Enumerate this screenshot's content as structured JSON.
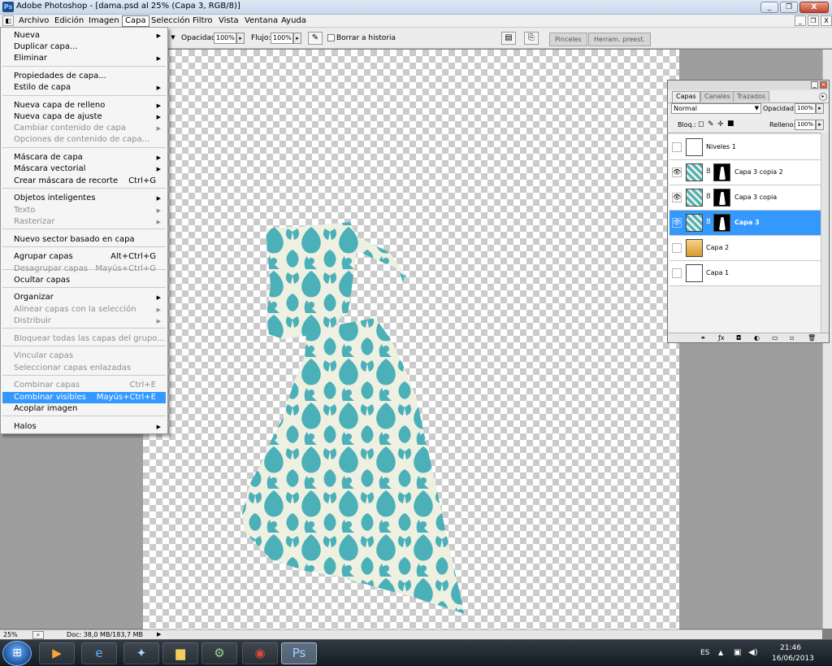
{
  "window": {
    "title": "Adobe Photoshop - [dama.psd al 25% (Capa 3, RGB/8)]",
    "buttons": [
      "_",
      "❐",
      "X"
    ],
    "doc_buttons": [
      "_",
      "❐",
      "X"
    ]
  },
  "menubar": [
    "Archivo",
    "Edición",
    "Imagen",
    "Capa",
    "Selección",
    "Filtro",
    "Vista",
    "Ventana",
    "Ayuda"
  ],
  "options": {
    "opacity_label": "Opacidad:",
    "opacity_value": "100%",
    "flow_label": "Flujo:",
    "flow_value": "100%",
    "erase_history_label": "Borrar a historia",
    "palette_tabs": [
      "Pinceles",
      "Herram. preest."
    ]
  },
  "layer_menu": {
    "items": [
      {
        "label": "Nueva",
        "arrow": "▶",
        "disabled": false
      },
      {
        "label": "Duplicar capa...",
        "disabled": false
      },
      {
        "label": "Eliminar",
        "arrow": "▶",
        "disabled": false
      },
      {
        "label": "Propiedades de capa...",
        "disabled": false
      },
      {
        "label": "Estilo de capa",
        "arrow": "▶",
        "disabled": false
      },
      {
        "label": "Nueva capa de relleno",
        "arrow": "▶",
        "disabled": false
      },
      {
        "label": "Nueva capa de ajuste",
        "arrow": "▶",
        "disabled": false
      },
      {
        "label": "Cambiar contenido de capa",
        "arrow": "▶",
        "disabled": true
      },
      {
        "label": "Opciones de contenido de capa...",
        "disabled": true
      },
      {
        "label": "Máscara de capa",
        "arrow": "▶",
        "disabled": false
      },
      {
        "label": "Máscara vectorial",
        "arrow": "▶",
        "disabled": false
      },
      {
        "label": "Crear máscara de recorte",
        "shortcut": "Ctrl+G",
        "disabled": false
      },
      {
        "label": "Objetos inteligentes",
        "arrow": "▶",
        "disabled": false
      },
      {
        "label": "Texto",
        "arrow": "▶",
        "disabled": true
      },
      {
        "label": "Rasterizar",
        "arrow": "▶",
        "disabled": true
      },
      {
        "label": "Nuevo sector basado en capa",
        "disabled": false
      },
      {
        "label": "Agrupar capas",
        "shortcut": "Alt+Ctrl+G",
        "disabled": false
      },
      {
        "label": "Desagrupar capas",
        "shortcut": "Mayús+Ctrl+G",
        "disabled": true
      },
      {
        "label": "Ocultar capas",
        "disabled": false
      },
      {
        "label": "Organizar",
        "arrow": "▶",
        "disabled": false
      },
      {
        "label": "Alinear capas con la selección",
        "arrow": "▶",
        "disabled": true
      },
      {
        "label": "Distribuir",
        "arrow": "▶",
        "disabled": true
      },
      {
        "label": "Bloquear todas las capas del grupo...",
        "disabled": true
      },
      {
        "label": "Vincular capas",
        "disabled": true
      },
      {
        "label": "Seleccionar capas enlazadas",
        "disabled": true
      },
      {
        "label": "Combinar capas",
        "shortcut": "Ctrl+E",
        "disabled": true
      },
      {
        "label": "Combinar visibles",
        "shortcut": "Mayús+Ctrl+E",
        "disabled": false,
        "highlighted": true
      },
      {
        "label": "Acoplar imagen",
        "disabled": false
      },
      {
        "label": "Halos",
        "arrow": "▶",
        "disabled": false
      }
    ]
  },
  "layers_panel": {
    "tabs": [
      "Capas",
      "Canales",
      "Trazados"
    ],
    "blend_mode": "Normal",
    "opacity_label": "Opacidad:",
    "opacity_value": "100%",
    "lock_label": "Bloq.:",
    "fill_label": "Relleno:",
    "fill_value": "100%",
    "eye_glyph": "👁",
    "chain_glyph": "8",
    "layers": [
      {
        "name": "Niveles 1",
        "visible": false,
        "has_mask": false,
        "selected": false
      },
      {
        "name": "Capa 3 copia 2",
        "visible": true,
        "has_mask": true,
        "selected": false
      },
      {
        "name": "Capa 3 copia",
        "visible": true,
        "has_mask": true,
        "selected": false
      },
      {
        "name": "Capa 3",
        "visible": true,
        "has_mask": true,
        "selected": true
      },
      {
        "name": "Capa 2",
        "visible": false,
        "has_mask": false,
        "selected": false
      },
      {
        "name": "Capa 1",
        "visible": false,
        "has_mask": false,
        "selected": false
      }
    ],
    "footer_icons": [
      "⚭",
      "ƒx",
      "◘",
      "◐",
      "▭",
      "▫",
      "🗑"
    ]
  },
  "status": {
    "zoom": "25%",
    "doc": "Doc: 38,0 MB/183,7 MB"
  },
  "taskbar": {
    "language": "ES",
    "time": "21:46",
    "date": "16/06/2013"
  },
  "colors": {
    "pattern_teal": "#4bb0b8",
    "pattern_cream": "#eef0e2",
    "menu_highlight": "#3399ff"
  }
}
